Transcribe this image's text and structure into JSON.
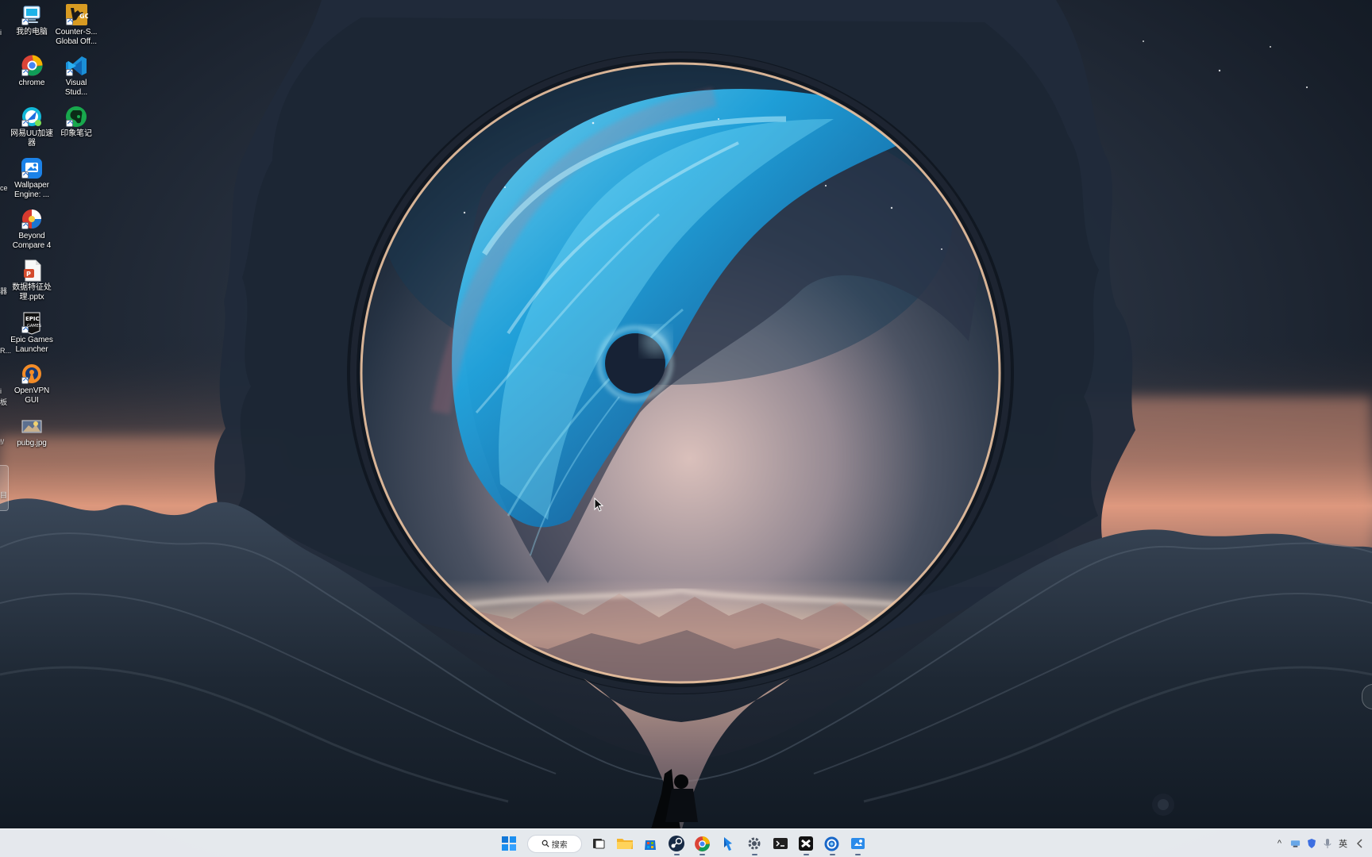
{
  "desktop": {
    "left_cut_labels": [
      "i",
      "ce",
      "器",
      "R...",
      "i",
      "板",
      "!/",
      "目"
    ],
    "icons": [
      {
        "label": "我的电脑",
        "icon": "computer-icon",
        "shortcut": true
      },
      {
        "label": "Counter-S...\nGlobal Off...",
        "icon": "csgo-icon",
        "shortcut": true
      },
      {
        "label": "chrome",
        "icon": "chrome-icon",
        "shortcut": true
      },
      {
        "label": "Visual\nStud...",
        "icon": "vscode-icon",
        "shortcut": true
      },
      {
        "label": "网易UU加速\n器",
        "icon": "uu-accelerator-icon",
        "shortcut": true
      },
      {
        "label": "印象笔记",
        "icon": "evernote-icon",
        "shortcut": true
      },
      {
        "label": "Wallpaper\nEngine: ...",
        "icon": "wallpaper-engine-icon",
        "shortcut": true
      },
      {
        "label": "Beyond\nCompare 4",
        "icon": "beyond-compare-icon",
        "shortcut": true
      },
      {
        "label": "数据特征处\n理.pptx",
        "icon": "pptx-file-icon",
        "shortcut": false
      },
      {
        "label": "Epic Games\nLauncher",
        "icon": "epic-games-icon",
        "shortcut": true
      },
      {
        "label": "OpenVPN\nGUI",
        "icon": "openvpn-icon",
        "shortcut": true
      },
      {
        "label": "pubg.jpg",
        "icon": "image-file-icon",
        "shortcut": false
      }
    ]
  },
  "taskbar": {
    "search_label": "搜索",
    "apps": [
      {
        "name": "windows-start",
        "icon": "windows-logo-icon",
        "active": false
      },
      {
        "name": "task-view",
        "icon": "task-view-icon",
        "active": false
      },
      {
        "name": "file-explorer",
        "icon": "folder-icon",
        "active": false
      },
      {
        "name": "microsoft-store",
        "icon": "store-icon",
        "active": false
      },
      {
        "name": "steam",
        "icon": "steam-icon",
        "active": true
      },
      {
        "name": "chrome",
        "icon": "chrome-icon",
        "active": true
      },
      {
        "name": "pin-app",
        "icon": "pin-app-icon",
        "active": false
      },
      {
        "name": "settings",
        "icon": "settings-gear-icon",
        "active": true
      },
      {
        "name": "terminal",
        "icon": "terminal-icon",
        "active": false
      },
      {
        "name": "capcut",
        "icon": "capcut-icon",
        "active": true
      },
      {
        "name": "browser-circle",
        "icon": "browser-circle-icon",
        "active": true
      },
      {
        "name": "screen-capture",
        "icon": "screen-capture-icon",
        "active": true
      }
    ],
    "tray": {
      "chevron": "^",
      "input_language": "英"
    }
  },
  "colors": {
    "taskbar_bg": "#eef1f6",
    "portal_rim": "#f3c8a4",
    "galaxy_blue": "#28a9e6",
    "sunset_orange": "#f3a27d",
    "night_sky": "#151d2a"
  }
}
